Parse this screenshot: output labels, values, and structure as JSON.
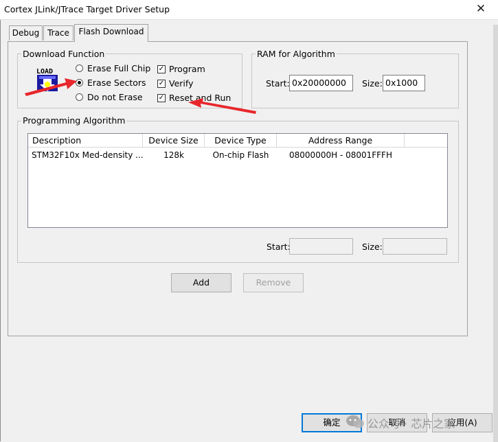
{
  "window": {
    "title": "Cortex JLink/JTrace Target Driver Setup",
    "close_glyph": "✕"
  },
  "tabs": [
    {
      "label": "Debug",
      "active": false
    },
    {
      "label": "Trace",
      "active": false
    },
    {
      "label": "Flash Download",
      "active": true
    }
  ],
  "download_function": {
    "legend": "Download Function",
    "icon_text": "LOAD",
    "radios": [
      {
        "label": "Erase Full Chip",
        "checked": false
      },
      {
        "label": "Erase Sectors",
        "checked": true
      },
      {
        "label": "Do not Erase",
        "checked": false
      }
    ],
    "checkboxes": [
      {
        "label": "Program",
        "checked": true
      },
      {
        "label": "Verify",
        "checked": true
      },
      {
        "label": "Reset and Run",
        "checked": true
      }
    ]
  },
  "ram_for_algorithm": {
    "legend": "RAM for Algorithm",
    "start_label": "Start:",
    "start_value": "0x20000000",
    "size_label": "Size:",
    "size_value": "0x1000"
  },
  "programming_algorithm": {
    "legend": "Programming Algorithm",
    "columns": [
      "Description",
      "Device Size",
      "Device Type",
      "Address Range"
    ],
    "rows": [
      {
        "description": "STM32F10x Med-density ...",
        "device_size": "128k",
        "device_type": "On-chip Flash",
        "address_range": "08000000H - 08001FFFH"
      }
    ],
    "start_label": "Start:",
    "start_value": "",
    "size_label": "Size:",
    "size_value": ""
  },
  "buttons": {
    "add": "Add",
    "remove": "Remove",
    "ok": "确定",
    "cancel": "取消",
    "apply": "应用(A)"
  },
  "watermark": "公众号 · 芯片之家",
  "colors": {
    "accent": "#0078d7",
    "arrow": "#e8262b"
  }
}
